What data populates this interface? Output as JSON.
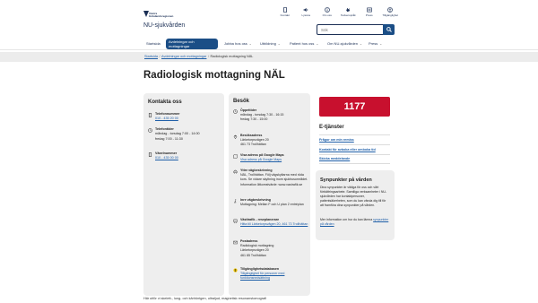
{
  "header": {
    "logo_line1": "Västra",
    "logo_line2": "Götalandsregionen",
    "site_name": "NU-sjukvården",
    "utilities": [
      {
        "label": "Kontakt",
        "icon": "phone-icon"
      },
      {
        "label": "Lyssna",
        "icon": "speaker-icon"
      },
      {
        "label": "Om oss",
        "icon": "info-icon"
      },
      {
        "label": "Teckenspråk",
        "icon": "hand-icon"
      },
      {
        "label": "Press",
        "icon": "newspaper-icon"
      },
      {
        "label": "Tillgänglighet",
        "icon": "accessibility-icon"
      }
    ],
    "search_placeholder": "Sök"
  },
  "nav": {
    "items": [
      {
        "label": "Startsida",
        "dropdown": false,
        "active": false
      },
      {
        "label": "Avdelningar och mottagningar",
        "dropdown": false,
        "active": true
      },
      {
        "label": "Jobba hos oss",
        "dropdown": true,
        "active": false
      },
      {
        "label": "Utbildning",
        "dropdown": true,
        "active": false
      },
      {
        "label": "Patient hos oss",
        "dropdown": true,
        "active": false
      },
      {
        "label": "Om NU-sjukvården",
        "dropdown": true,
        "active": false
      },
      {
        "label": "Press",
        "dropdown": true,
        "active": false
      }
    ]
  },
  "breadcrumb": {
    "items": [
      "Startsida",
      "Avdelningar och mottagningar",
      "Radiologisk mottagning NÄL"
    ]
  },
  "page": {
    "title": "Radiologisk mottagning NÄL",
    "intro": "Här utför vi skelett-, lung- och kärlröntgen, ultraljud, magnetisk resonanstomografi"
  },
  "contact": {
    "heading": "Kontakta oss",
    "phone_label": "Telefonnummer",
    "phone_value": "010 - 435 20 00",
    "hours_label": "Telefontider",
    "hours_line1": "måndag - torsdag 7:00 - 14:00",
    "hours_line2": "fredag 7:00 - 11:30",
    "switch_label": "Växelnummer",
    "switch_value": "010 - 435 00 00"
  },
  "visit": {
    "heading": "Besök",
    "open_label": "Öppettider",
    "open_line1": "måndag - torsdag 7:30 - 16:15",
    "open_line2": "fredag 7:30 - 15:00",
    "address_label": "Besöksadress",
    "address_line1": "Lärketorpsvägen 20",
    "address_line2": "461 73 Trollhättan",
    "maps_label": "Visa adress på Google Maps",
    "maps_link": "Visa adress på Google Maps",
    "west_label": "Yttre vägbeskrivning",
    "west_text": "NÄL, Trollhättan. Följ vägskyltarna med röda kors. Se vidare skyltning inom sjukhusområdet. Information åtkomstvärde: www.vastrafik.se",
    "inner_label": "Inre vägbeskrivning",
    "inner_text": "Mottagning: Mellan F och U plan 2 entréplan",
    "vt_label": "Västtrafik - reseplanerare",
    "vt_link": "Hitta till Lärketorpsvägen 20, 461 73 Trollhättan",
    "post_label": "Postadress",
    "post_line1": "Radiologisk mottagning",
    "post_line2": "Lärketorpsvägen 20",
    "post_line3": "461 85 Trollhättan",
    "tdb_label": "Tillgänglighetsdatabasen",
    "tdb_link": "Tillgänglighet för personer med funktionsnedsättning"
  },
  "sidebar": {
    "badge": "1177",
    "eservices_heading": "E-tjänster",
    "eservices": [
      "Frågor om min remiss",
      "Kontakt för avboka eller omboka tid",
      "Skicka meddelande"
    ],
    "feedback_heading": "Synpunkter på vården",
    "feedback_text1": "Dina synpunkter är viktiga för oss och vårt förbättringsarbete. Samtliga verksamheter i NU-sjukvården har kontaktpersoner, patientsäkerheten, som du kan vända dig till för att framföra dina synpunkter på vården.",
    "feedback_text2_prefix": "Mer information om hur du kan lämna ",
    "feedback_link": "synpunkter på vården"
  }
}
